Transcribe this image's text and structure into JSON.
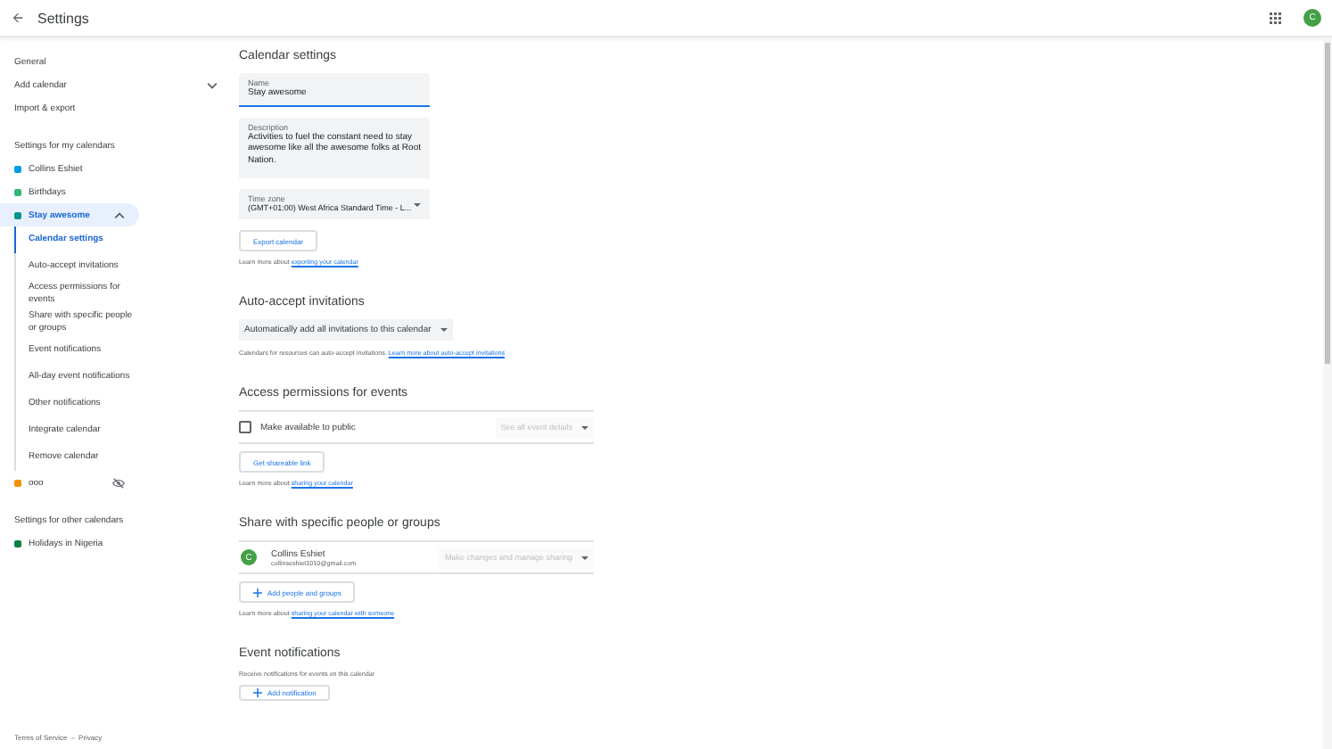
{
  "header": {
    "title": "Settings",
    "avatar_letter": "C"
  },
  "sidebar": {
    "top_items": [
      {
        "label": "General",
        "kind": "link"
      },
      {
        "label": "Add calendar",
        "kind": "menu"
      },
      {
        "label": "Import & export",
        "kind": "link"
      }
    ],
    "my_calendars_title": "Settings for my calendars",
    "my_calendars": [
      {
        "name": "Collins Eshiet",
        "color": "#039be5",
        "selected": false,
        "expanded": false,
        "hidden": false
      },
      {
        "name": "Birthdays",
        "color": "#33b679",
        "selected": false,
        "expanded": false,
        "hidden": false
      },
      {
        "name": "Stay awesome",
        "color": "#009688",
        "selected": true,
        "expanded": true,
        "hidden": false,
        "children": [
          {
            "label": "Calendar settings",
            "selected": true
          },
          {
            "label": "Auto-accept invitations",
            "selected": false
          },
          {
            "label": "Access permissions for events",
            "selected": false
          },
          {
            "label": "Share with specific people or groups",
            "selected": false
          },
          {
            "label": "Event notifications",
            "selected": false
          },
          {
            "label": "All-day event notifications",
            "selected": false
          },
          {
            "label": "Other notifications",
            "selected": false
          },
          {
            "label": "Integrate calendar",
            "selected": false
          },
          {
            "label": "Remove calendar",
            "selected": false
          }
        ]
      },
      {
        "name": "ooo",
        "color": "#f09300",
        "selected": false,
        "expanded": false,
        "hidden": true
      }
    ],
    "other_calendars_title": "Settings for other calendars",
    "other_calendars": [
      {
        "name": "Holidays in Nigeria",
        "color": "#0b8043"
      }
    ],
    "footer": {
      "terms": "Terms of Service",
      "separator": "–",
      "privacy": "Privacy"
    }
  },
  "calendar_settings": {
    "title": "Calendar settings",
    "name_label": "Name",
    "name_value": "Stay awesome",
    "description_label": "Description",
    "description_value": "Activities to fuel the constant need to stay awesome like all the awesome folks at Root Nation.",
    "time_zone_label": "Time zone",
    "time_zone_value": "(GMT+01:00) West Africa Standard Time - L...",
    "export_button": "Export calendar",
    "learn_more": "Learn more about",
    "learn_more_link": "exporting your calendar"
  },
  "auto_accept": {
    "title": "Auto-accept invitations",
    "dropdown": "Automatically add all invitations to this calendar",
    "note": "Calendars for resources can auto-accept invitations.",
    "note_link": "Learn more about auto-accept invitations"
  },
  "access_permissions": {
    "title": "Access permissions for events",
    "public_label": "Make available to public",
    "public_checked": false,
    "details_dropdown": "See all event details",
    "details_disabled": true,
    "shareable_link_button": "Get shareable link",
    "learn_more": "Learn more about",
    "learn_more_link": "sharing your calendar"
  },
  "share": {
    "title": "Share with specific people or groups",
    "people": [
      {
        "name": "Collins Eshiet",
        "email": "collinseshiet1010@gmail.com",
        "avatar_letter": "C",
        "permission": "Make changes and manage sharing"
      }
    ],
    "add_button": "Add people and groups",
    "learn_more": "Learn more about",
    "learn_more_link": "sharing your calendar with someone"
  },
  "event_notifications": {
    "title": "Event notifications",
    "description": "Receive notifications for events on this calendar",
    "add_button": "Add notification"
  }
}
